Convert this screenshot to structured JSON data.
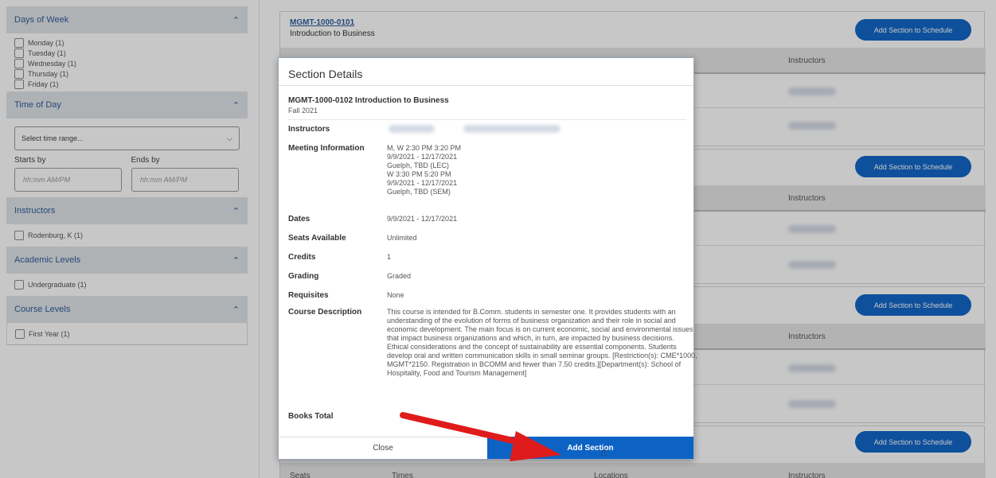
{
  "sidebar": {
    "days_of_week": {
      "title": "Days of Week",
      "items": [
        "Monday (1)",
        "Tuesday (1)",
        "Wednesday (1)",
        "Thursday (1)",
        "Friday (1)"
      ]
    },
    "time_of_day": {
      "title": "Time of Day",
      "select_placeholder": "Select time range...",
      "starts_label": "Starts by",
      "ends_label": "Ends by",
      "starts_placeholder": "hh:mm AM/PM",
      "ends_placeholder": "hh:mm AM/PM"
    },
    "instructors": {
      "title": "Instructors",
      "item": "Rodenburg, K (1)"
    },
    "academic_levels": {
      "title": "Academic Levels",
      "item": "Undergraduate (1)"
    },
    "course_levels": {
      "title": "Course Levels",
      "item": "First Year (1)"
    }
  },
  "cards": [
    {
      "code": "MGMT-1000-0101",
      "name": "Introduction to Business",
      "add_label": "Add Section to Schedule",
      "col_instructors": "Instructors"
    },
    {
      "add_label": "Add Section to Schedule",
      "col_instructors": "Instructors"
    },
    {
      "add_label": "Add Section to Schedule",
      "col_instructors": "Instructors"
    },
    {
      "add_label": "Add Section to Schedule",
      "col_seats": "Seats",
      "col_times": "Times",
      "col_locations": "Locations",
      "col_instructors": "Instructors"
    }
  ],
  "modal": {
    "title": "Section Details",
    "section_title": "MGMT-1000-0102 Introduction to Business",
    "term": "Fall 2021",
    "labels": {
      "instructors": "Instructors",
      "meeting": "Meeting Information",
      "dates": "Dates",
      "seats": "Seats Available",
      "credits": "Credits",
      "grading": "Grading",
      "requisites": "Requisites",
      "description": "Course Description",
      "books": "Books Total"
    },
    "meeting_lines": [
      "M, W 2:30 PM 3:20 PM",
      "9/9/2021 - 12/17/2021",
      "Guelph, TBD (LEC)",
      "W 3:30 PM 5:20 PM",
      "9/9/2021 - 12/17/2021",
      "Guelph, TBD (SEM)"
    ],
    "dates": "9/9/2021 - 12/17/2021",
    "seats": "Unlimited",
    "credits": "1",
    "grading": "Graded",
    "requisites": "None",
    "description": "This course is intended for B.Comm. students in semester one. It provides students with an understanding of the evolution of forms of business organization and their role in social and economic development. The main focus is on current economic, social and environmental issues that impact business organizations and which, in turn, are impacted by business decisions. Ethical considerations and the concept of sustainability are essential components. Students develop oral and written communication skills in small seminar groups. [Restriction(s): CME*1000, MGMT*2150. Registration in BCOMM and fewer than 7.50 credits.][Department(s): School of Hospitality, Food and Tourism Management]",
    "close_label": "Close",
    "add_label": "Add Section"
  },
  "colors": {
    "accent": "#1367c8",
    "arrow": "#e01b1b"
  }
}
